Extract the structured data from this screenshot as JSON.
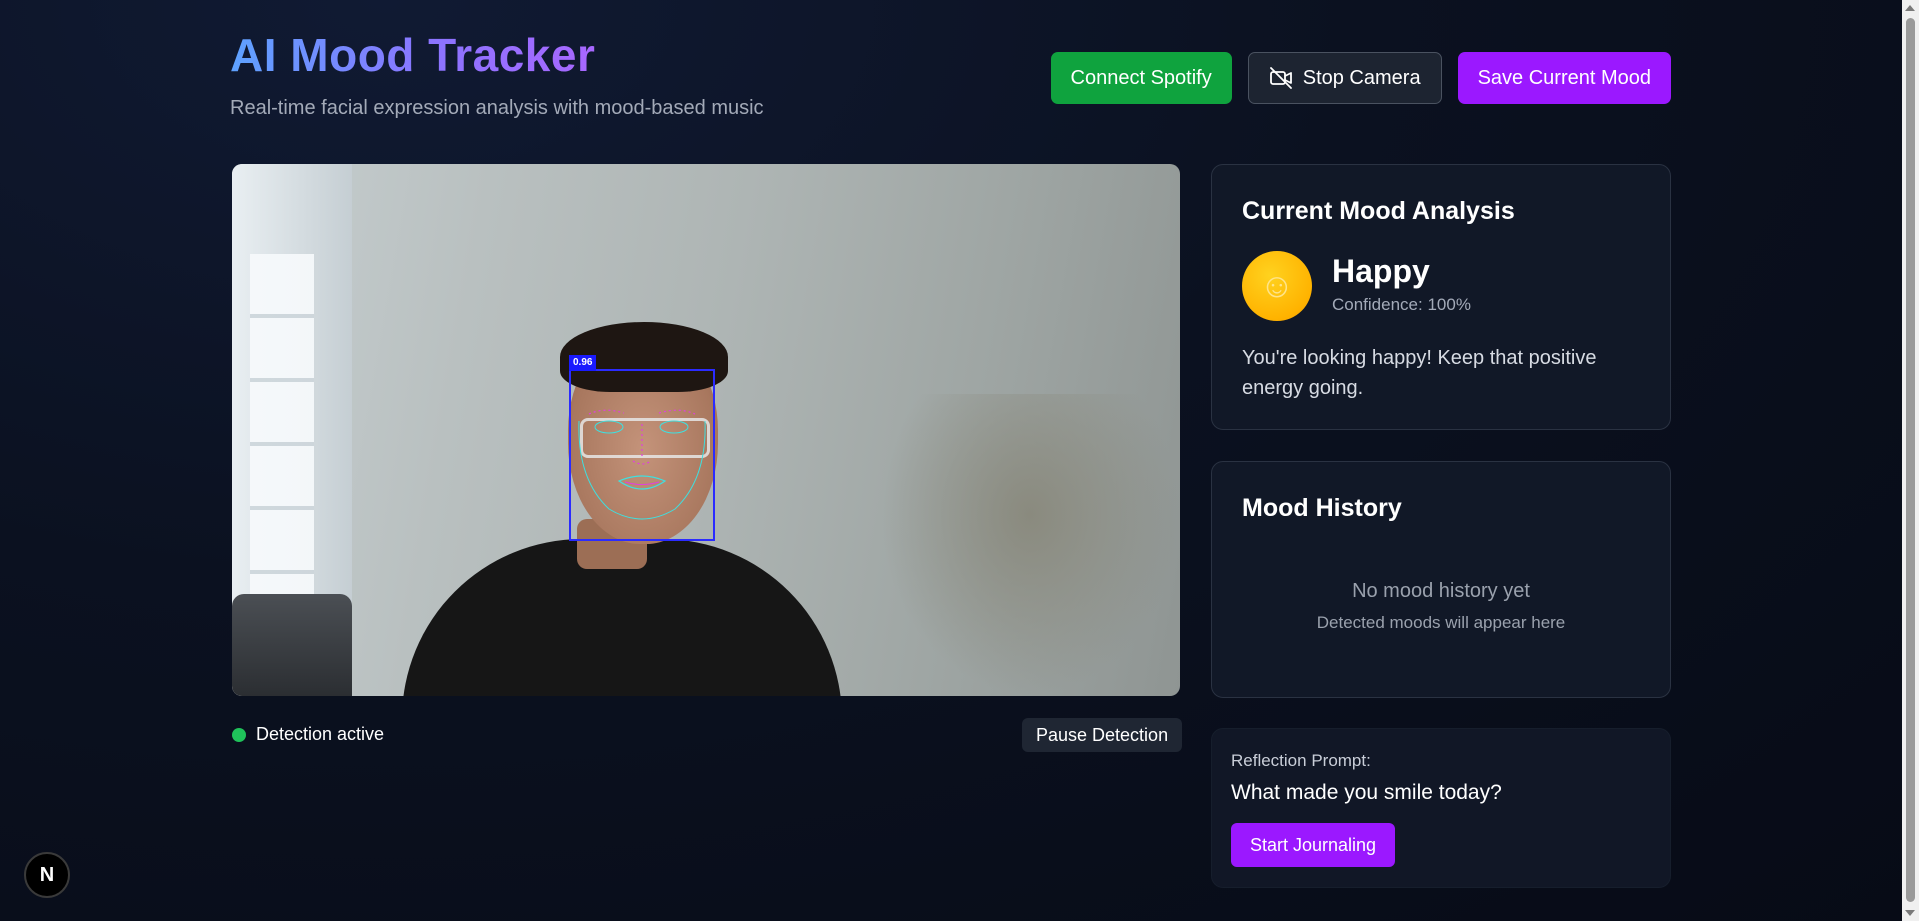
{
  "header": {
    "title": "AI Mood Tracker",
    "subtitle": "Real-time facial expression analysis with mood-based music",
    "connect_spotify": "Connect Spotify",
    "stop_camera": "Stop Camera",
    "save_mood": "Save Current Mood"
  },
  "video": {
    "face_score": "0.96",
    "status": "Detection active",
    "pause_label": "Pause Detection"
  },
  "mood": {
    "heading": "Current Mood Analysis",
    "emoji": "☺",
    "name": "Happy",
    "confidence": "Confidence: 100%",
    "description": "You're looking happy! Keep that positive energy going."
  },
  "history": {
    "heading": "Mood History",
    "empty": "No mood history yet",
    "sub": "Detected moods will appear here"
  },
  "reflection": {
    "label": "Reflection Prompt:",
    "question": "What made you smile today?",
    "button": "Start Journaling"
  },
  "badge": {
    "letter": "N"
  },
  "colors": {
    "spotify": "#0fa33e",
    "accent": "#9b18ff",
    "status_green": "#1fc25a",
    "mood_yellow": "#ffb300"
  }
}
